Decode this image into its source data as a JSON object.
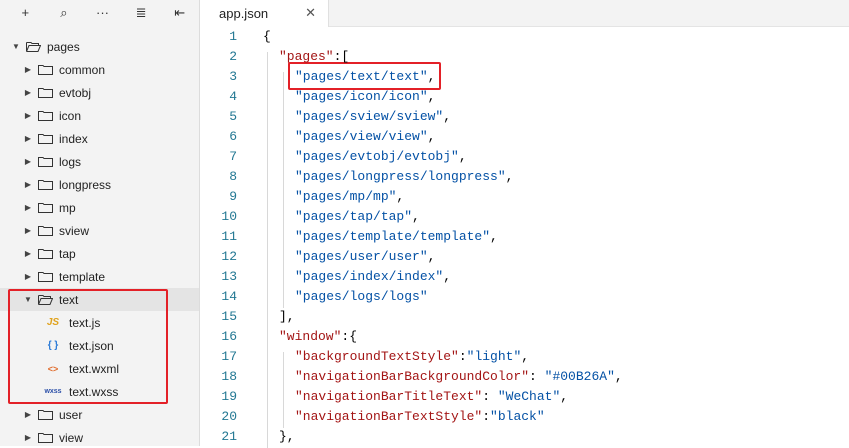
{
  "toolbar": {
    "icons": [
      "plus-icon",
      "search-icon",
      "more-icon",
      "sort-icon",
      "collapse-icon"
    ],
    "glyphs": [
      "+",
      "⌕",
      "···",
      "≣",
      "⇤"
    ]
  },
  "tree": {
    "root": {
      "label": "pages",
      "expanded": true
    },
    "folders_before": [
      "common",
      "evtobj",
      "icon",
      "index",
      "logs",
      "longpress",
      "mp",
      "sview",
      "tap",
      "template"
    ],
    "selected_folder": "text",
    "files": [
      {
        "badge": "JS",
        "label": "text.js",
        "type": "js"
      },
      {
        "badge": "{ }",
        "label": "text.json",
        "type": "json"
      },
      {
        "badge": "<>",
        "label": "text.wxml",
        "type": "wxml"
      },
      {
        "badge": "wxss",
        "label": "text.wxss",
        "type": "wxss"
      }
    ],
    "folders_after": [
      "user",
      "view"
    ]
  },
  "editor": {
    "tab": {
      "label": "app.json",
      "close": "✕"
    },
    "lines": [
      {
        "n": "1",
        "indent": 0,
        "parts": [
          {
            "t": "pun",
            "v": "{"
          }
        ]
      },
      {
        "n": "2",
        "indent": 1,
        "parts": [
          {
            "t": "key",
            "v": "\"pages\""
          },
          {
            "t": "pun",
            "v": ":["
          }
        ]
      },
      {
        "n": "3",
        "indent": 2,
        "parts": [
          {
            "t": "str",
            "v": "\"pages/text/text\""
          },
          {
            "t": "pun",
            "v": ","
          }
        ]
      },
      {
        "n": "4",
        "indent": 2,
        "parts": [
          {
            "t": "str",
            "v": "\"pages/icon/icon\""
          },
          {
            "t": "pun",
            "v": ","
          }
        ]
      },
      {
        "n": "5",
        "indent": 2,
        "parts": [
          {
            "t": "str",
            "v": "\"pages/sview/sview\""
          },
          {
            "t": "pun",
            "v": ","
          }
        ]
      },
      {
        "n": "6",
        "indent": 2,
        "parts": [
          {
            "t": "str",
            "v": "\"pages/view/view\""
          },
          {
            "t": "pun",
            "v": ","
          }
        ]
      },
      {
        "n": "7",
        "indent": 2,
        "parts": [
          {
            "t": "str",
            "v": "\"pages/evtobj/evtobj\""
          },
          {
            "t": "pun",
            "v": ","
          }
        ]
      },
      {
        "n": "8",
        "indent": 2,
        "parts": [
          {
            "t": "str",
            "v": "\"pages/longpress/longpress\""
          },
          {
            "t": "pun",
            "v": ","
          }
        ]
      },
      {
        "n": "9",
        "indent": 2,
        "parts": [
          {
            "t": "str",
            "v": "\"pages/mp/mp\""
          },
          {
            "t": "pun",
            "v": ","
          }
        ]
      },
      {
        "n": "10",
        "indent": 2,
        "parts": [
          {
            "t": "str",
            "v": "\"pages/tap/tap\""
          },
          {
            "t": "pun",
            "v": ","
          }
        ]
      },
      {
        "n": "11",
        "indent": 2,
        "parts": [
          {
            "t": "str",
            "v": "\"pages/template/template\""
          },
          {
            "t": "pun",
            "v": ","
          }
        ]
      },
      {
        "n": "12",
        "indent": 2,
        "parts": [
          {
            "t": "str",
            "v": "\"pages/user/user\""
          },
          {
            "t": "pun",
            "v": ","
          }
        ]
      },
      {
        "n": "13",
        "indent": 2,
        "parts": [
          {
            "t": "str",
            "v": "\"pages/index/index\""
          },
          {
            "t": "pun",
            "v": ","
          }
        ]
      },
      {
        "n": "14",
        "indent": 2,
        "parts": [
          {
            "t": "str",
            "v": "\"pages/logs/logs\""
          }
        ]
      },
      {
        "n": "15",
        "indent": 1,
        "parts": [
          {
            "t": "pun",
            "v": "],"
          }
        ]
      },
      {
        "n": "16",
        "indent": 1,
        "parts": [
          {
            "t": "key",
            "v": "\"window\""
          },
          {
            "t": "pun",
            "v": ":{"
          }
        ]
      },
      {
        "n": "17",
        "indent": 2,
        "parts": [
          {
            "t": "key",
            "v": "\"backgroundTextStyle\""
          },
          {
            "t": "pun",
            "v": ":"
          },
          {
            "t": "str",
            "v": "\"light\""
          },
          {
            "t": "pun",
            "v": ","
          }
        ]
      },
      {
        "n": "18",
        "indent": 2,
        "parts": [
          {
            "t": "key",
            "v": "\"navigationBarBackgroundColor\""
          },
          {
            "t": "pun",
            "v": ": "
          },
          {
            "t": "str",
            "v": "\"#00B26A\""
          },
          {
            "t": "pun",
            "v": ","
          }
        ]
      },
      {
        "n": "19",
        "indent": 2,
        "parts": [
          {
            "t": "key",
            "v": "\"navigationBarTitleText\""
          },
          {
            "t": "pun",
            "v": ": "
          },
          {
            "t": "str",
            "v": "\"WeChat\""
          },
          {
            "t": "pun",
            "v": ","
          }
        ]
      },
      {
        "n": "20",
        "indent": 2,
        "parts": [
          {
            "t": "key",
            "v": "\"navigationBarTextStyle\""
          },
          {
            "t": "pun",
            "v": ":"
          },
          {
            "t": "str",
            "v": "\"black\""
          }
        ]
      },
      {
        "n": "21",
        "indent": 1,
        "parts": [
          {
            "t": "pun",
            "v": "},"
          }
        ]
      }
    ]
  },
  "colors": {
    "highlight_box": "#e32027",
    "string": "#0451a5",
    "key": "#a31515",
    "line_number": "#237893",
    "sidebar_bg": "#f3f3f3"
  }
}
